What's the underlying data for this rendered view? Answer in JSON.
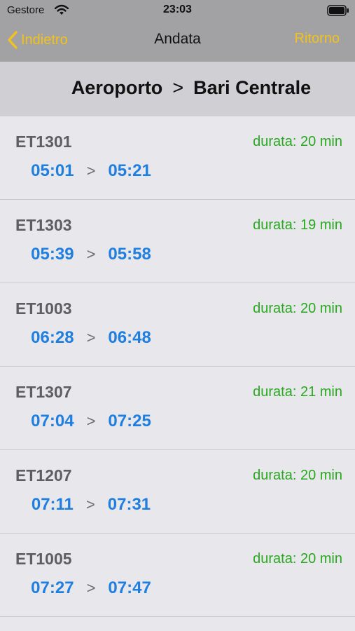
{
  "status": {
    "carrier": "Gestore",
    "time": "23:03"
  },
  "nav": {
    "back_label": "Indietro",
    "title": "Andata",
    "return_label": "Ritorno"
  },
  "route": {
    "from": "Aeroporto",
    "separator": ">",
    "to": "Bari Centrale"
  },
  "trains": [
    {
      "code": "ET1301",
      "duration": "durata: 20 min",
      "depart": "05:01",
      "arrive": "05:21"
    },
    {
      "code": "ET1303",
      "duration": "durata: 19 min",
      "depart": "05:39",
      "arrive": "05:58"
    },
    {
      "code": "ET1003",
      "duration": "durata: 20 min",
      "depart": "06:28",
      "arrive": "06:48"
    },
    {
      "code": "ET1307",
      "duration": "durata: 21 min",
      "depart": "07:04",
      "arrive": "07:25"
    },
    {
      "code": "ET1207",
      "duration": "durata: 20 min",
      "depart": "07:11",
      "arrive": "07:31"
    },
    {
      "code": "ET1005",
      "duration": "durata: 20 min",
      "depart": "07:27",
      "arrive": "07:47"
    }
  ],
  "time_separator": ">",
  "colors": {
    "accent": "#f2c21b",
    "time": "#1f7fe0",
    "duration": "#29a81f"
  }
}
